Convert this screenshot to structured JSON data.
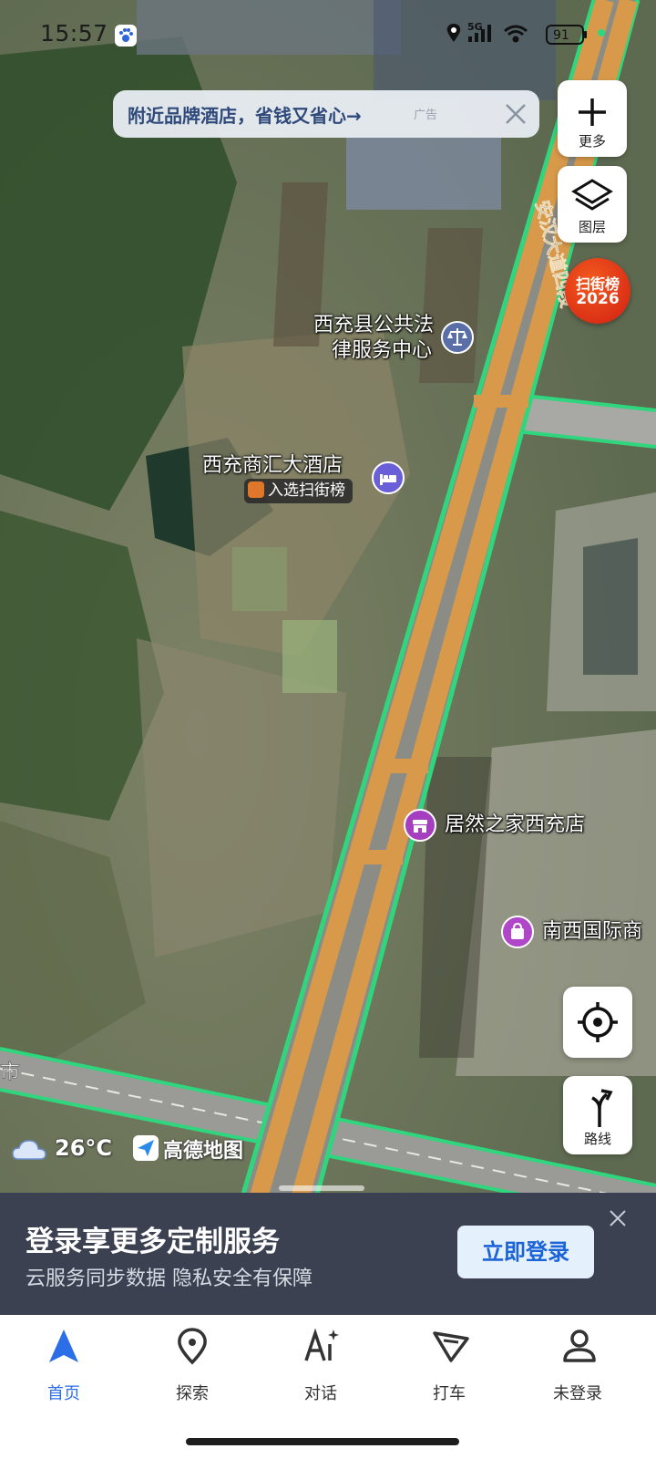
{
  "status_bar": {
    "time": "15:57",
    "network": "5G",
    "battery": "91"
  },
  "ad_banner": {
    "text": "附近品牌酒店，省钱又省心→",
    "tag": "广告"
  },
  "map_controls": {
    "more_label": "更多",
    "layers_label": "图层",
    "scan_list_line1": "扫街榜",
    "scan_list_line2": "2026",
    "route_label": "路线"
  },
  "map": {
    "road_name": "安汉大道四段",
    "road_label_left": "市",
    "pois": [
      {
        "name_line1": "西充县公共法",
        "name_line2": "律服务中心",
        "icon": "scales-icon",
        "color": "#5a6fa8"
      },
      {
        "name": "西充商汇大酒店",
        "icon": "hotel-bed-icon",
        "color": "#6a5fd8",
        "badge": "入选扫街榜"
      },
      {
        "name": "居然之家西充店",
        "icon": "store-icon",
        "color": "#a63fbf"
      },
      {
        "name": "南西国际商",
        "icon": "shopping-bag-icon",
        "color": "#b046c8"
      }
    ],
    "weather_temp": "26°C",
    "brand": "高德地图"
  },
  "login_panel": {
    "title": "登录享更多定制服务",
    "subtitle": "云服务同步数据 隐私安全有保障",
    "button": "立即登录"
  },
  "bottom_nav": {
    "tabs": [
      {
        "label": "首页",
        "icon": "navigation-arrow-icon",
        "active": true
      },
      {
        "label": "探索",
        "icon": "location-pin-icon",
        "active": false
      },
      {
        "label": "对话",
        "icon": "ai-chat-icon",
        "active": false
      },
      {
        "label": "打车",
        "icon": "taxi-flag-icon",
        "active": false
      },
      {
        "label": "未登录",
        "icon": "user-icon",
        "active": false
      }
    ]
  },
  "colors": {
    "accent": "#2c6ee8",
    "road": "#d89a4a",
    "road_edge": "#2fd67e",
    "login_bg": "#3b4150"
  }
}
